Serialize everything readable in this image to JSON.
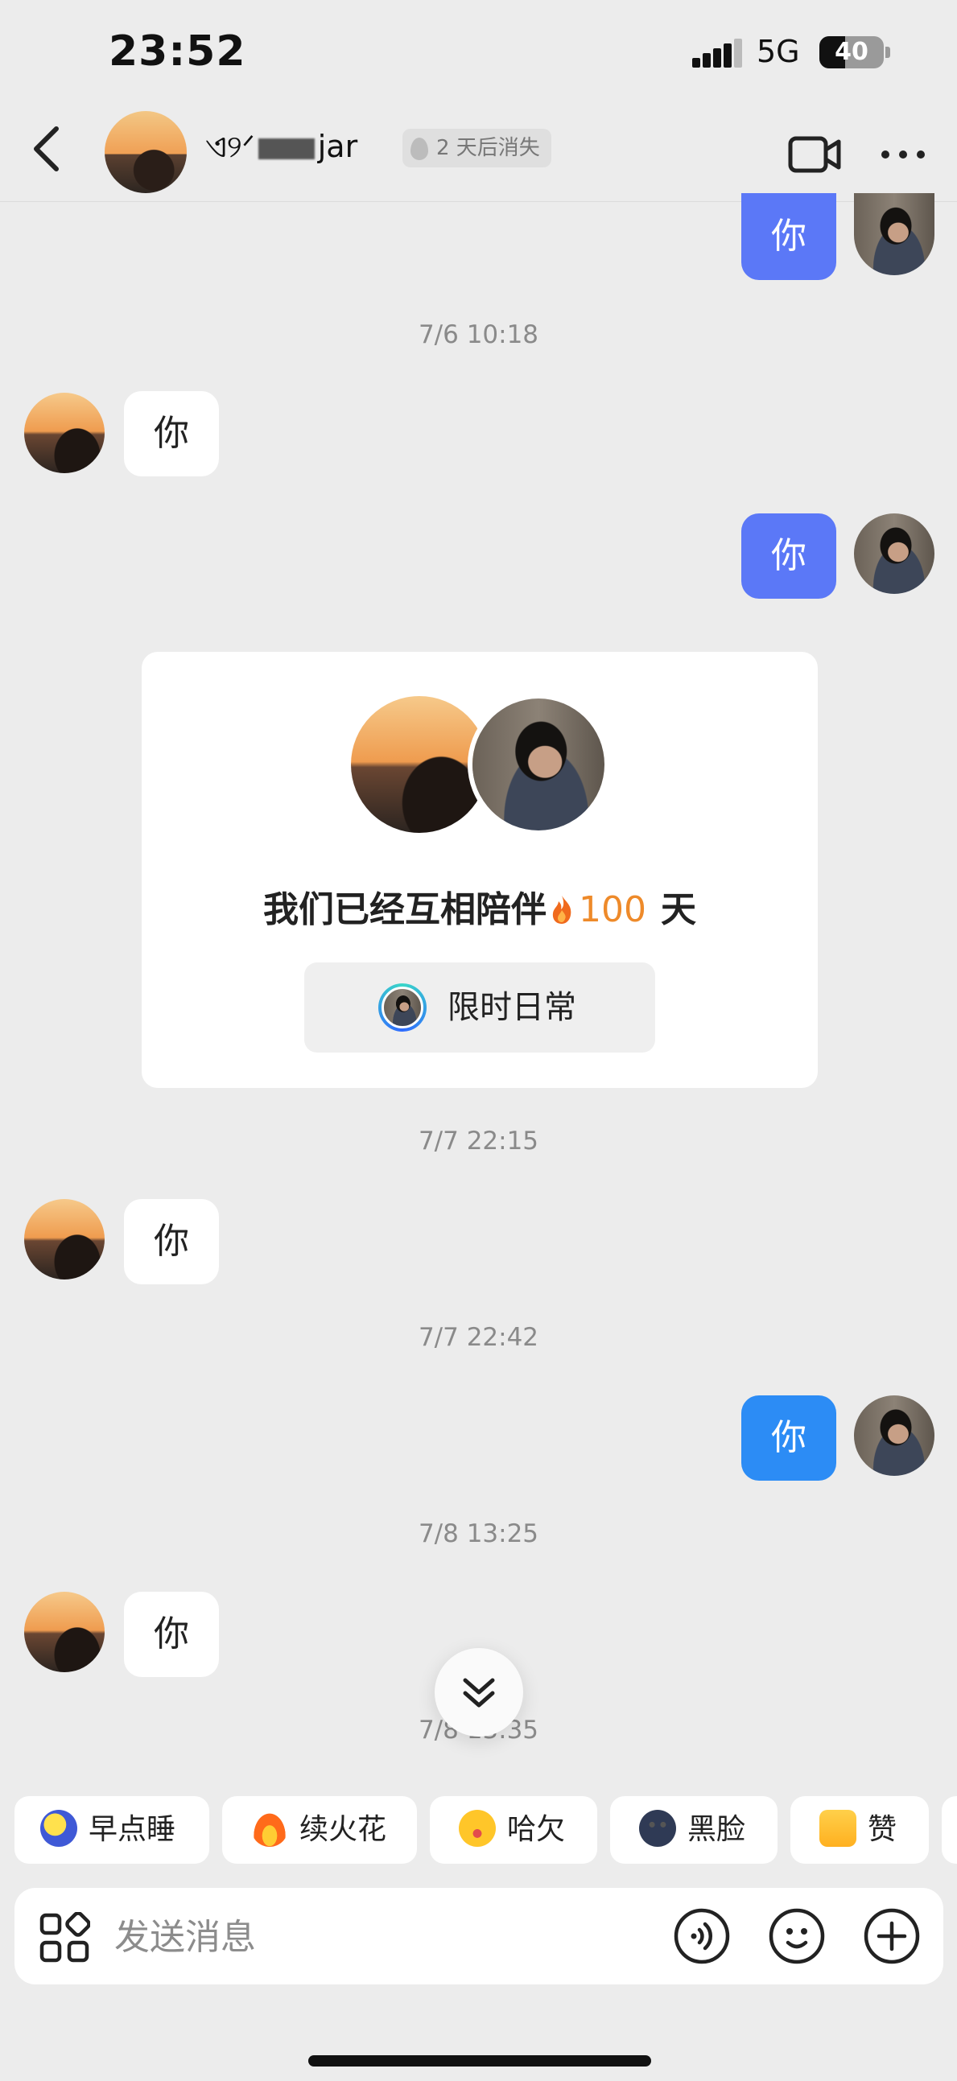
{
  "status_bar": {
    "time": "23:52",
    "network": "5G",
    "battery": "40",
    "battery_level_percent": 40
  },
  "header": {
    "contact_name_left": "ଏ୨ᐟ",
    "contact_name_right": "jar",
    "vanish_label": "2 天后消失",
    "icons": {
      "back": "chevron-left-icon",
      "video": "video-camera-icon",
      "more": "ellipsis-icon"
    }
  },
  "messages": [
    {
      "id": "m1",
      "side": "out",
      "text": "你"
    },
    {
      "id": "ts1",
      "type": "timestamp",
      "text": "7/6 10:18"
    },
    {
      "id": "m2",
      "side": "in",
      "text": "你"
    },
    {
      "id": "m3",
      "side": "out",
      "text": "你"
    },
    {
      "id": "ts2",
      "type": "timestamp",
      "text": "7/7 22:15"
    },
    {
      "id": "m4",
      "side": "in",
      "text": "你"
    },
    {
      "id": "ts3",
      "type": "timestamp",
      "text": "7/7 22:42"
    },
    {
      "id": "m5",
      "side": "out",
      "text": "你"
    },
    {
      "id": "ts4",
      "type": "timestamp",
      "text": "7/8 13:25"
    },
    {
      "id": "m6",
      "side": "in",
      "text": "你"
    },
    {
      "id": "ts5",
      "type": "timestamp",
      "text": "7/8 13:35"
    }
  ],
  "companion_card": {
    "title_prefix": "我们已经互相陪伴",
    "days": "100",
    "title_suffix": "天",
    "button_label": "限时日常"
  },
  "quick_replies": [
    {
      "label": "早点睡",
      "icon": "sleeping-moon-icon"
    },
    {
      "label": "续火花",
      "icon": "fire-icon"
    },
    {
      "label": "哈欠",
      "icon": "yawn-face-icon"
    },
    {
      "label": "黑脸",
      "icon": "dark-face-icon"
    },
    {
      "label": "赞",
      "icon": "thumbs-up-icon"
    }
  ],
  "input_bar": {
    "placeholder": "发送消息",
    "value": ""
  },
  "colors": {
    "outgoing_bubble": "#5b78f7",
    "outgoing_bubble_alt": "#2c8cf5",
    "streak_number": "#ee8a2a",
    "background": "#ececec"
  }
}
